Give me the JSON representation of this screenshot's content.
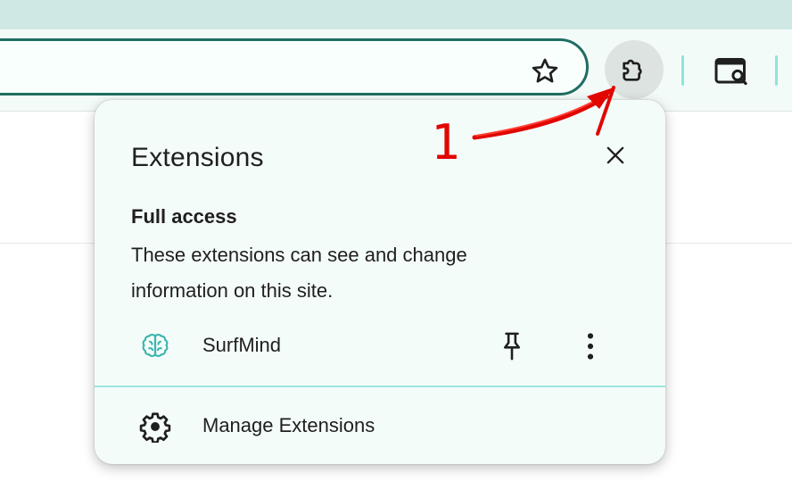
{
  "browser": {
    "bookmark_icon": "star-icon",
    "extensions_icon": "puzzle-icon",
    "side_panel_icon": "search-panel-icon",
    "accent_color": "#1f6d62"
  },
  "popup": {
    "title": "Extensions",
    "close_icon": "close-icon",
    "section_title": "Full access",
    "section_description": "These extensions can see and change information on this site.",
    "extensions": [
      {
        "name": "SurfMind",
        "icon": "brain-icon",
        "pin_icon": "pin-icon",
        "menu_icon": "more-vert-icon"
      }
    ],
    "manage_label": "Manage Extensions",
    "manage_icon": "gear-icon"
  },
  "annotation": {
    "number": "1",
    "color": "#e10600"
  }
}
